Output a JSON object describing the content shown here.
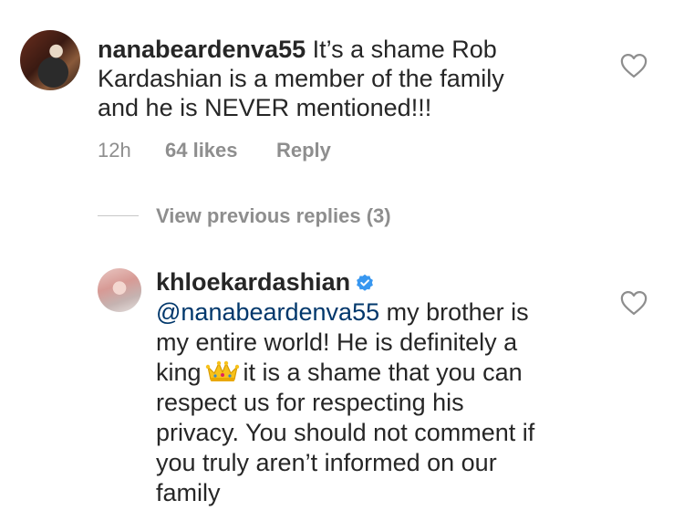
{
  "comment": {
    "username": "nanabeardenva55",
    "line1": "It’s a shame Rob",
    "line2": "Kardashian is a member of the family",
    "line3": "and he is NEVER mentioned!!!",
    "time": "12h",
    "likes": "64 likes",
    "reply_label": "Reply"
  },
  "view_replies": "View previous replies (3)",
  "reply": {
    "username": "khloekardashian",
    "mention": "@nanabeardenva55",
    "line1_rest": " my brother is",
    "line2": "my entire world! He is definitely a",
    "line3_start": "king",
    "line3_end": "it is a shame that you can",
    "line4": "respect us for respecting his",
    "line5": "privacy. You should not comment if",
    "line6": "you truly aren’t informed on our",
    "line7": "family"
  },
  "icons": {
    "heart": "heart-outline-icon",
    "verified": "verified-badge-icon",
    "crown": "crown-emoji"
  },
  "colors": {
    "text": "#262626",
    "meta": "#8e8e8e",
    "mention": "#00376b",
    "verified": "#3897f0"
  }
}
